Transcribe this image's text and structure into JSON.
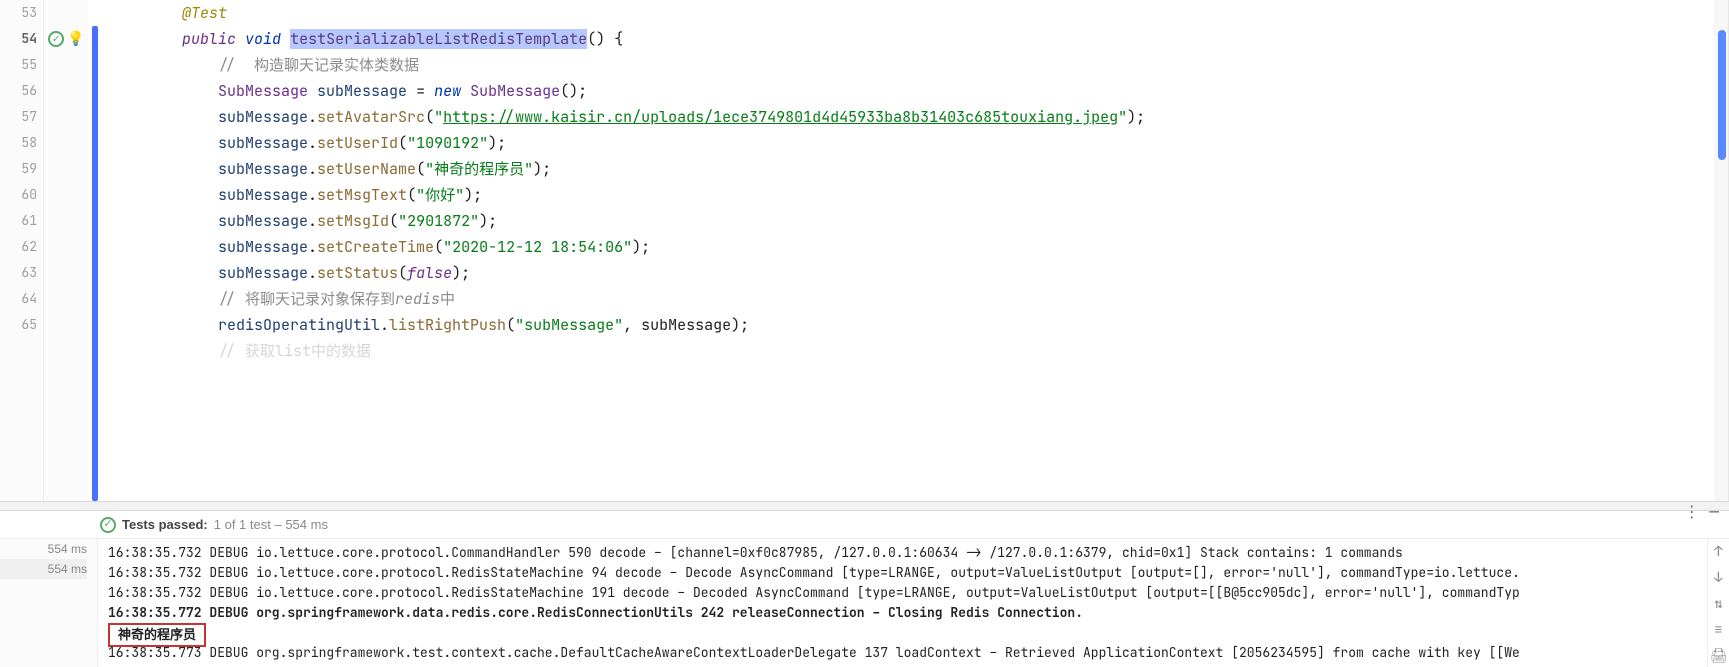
{
  "editor": {
    "lines": [
      {
        "num": "53",
        "indent": "        ",
        "segs": [
          {
            "t": "@Test",
            "c": "kw-anno"
          }
        ]
      },
      {
        "num": "54",
        "current": true,
        "markers": [
          "ok",
          "bulb"
        ],
        "indent": "        ",
        "segs": [
          {
            "t": "public",
            "c": "kw-pub"
          },
          {
            "t": " "
          },
          {
            "t": "void",
            "c": "kw-void"
          },
          {
            "t": " "
          },
          {
            "t": "testSerializableListRedisTemplate",
            "c": "fname sel"
          },
          {
            "t": "() {"
          }
        ]
      },
      {
        "num": "55",
        "indent": "            ",
        "segs": [
          {
            "t": "//  构造聊天记录实体类数据",
            "c": "cmt"
          }
        ]
      },
      {
        "num": "56",
        "indent": "            ",
        "segs": [
          {
            "t": "SubMessage",
            "c": "type"
          },
          {
            "t": " "
          },
          {
            "t": "subMessage",
            "c": "ident"
          },
          {
            "t": " = "
          },
          {
            "t": "new",
            "c": "kw-new"
          },
          {
            "t": " "
          },
          {
            "t": "SubMessage",
            "c": "type"
          },
          {
            "t": "();"
          }
        ]
      },
      {
        "num": "57",
        "indent": "            ",
        "segs": [
          {
            "t": "subMessage",
            "c": "ident"
          },
          {
            "t": "."
          },
          {
            "t": "setAvatarSrc",
            "c": "call"
          },
          {
            "t": "("
          },
          {
            "t": "\"",
            "c": "str"
          },
          {
            "t": "https://www.kaisir.cn/uploads/1ece3749801d4d45933ba8b31403c685touxiang.jpeg",
            "c": "strurl"
          },
          {
            "t": "\"",
            "c": "str"
          },
          {
            "t": ");"
          }
        ]
      },
      {
        "num": "58",
        "indent": "            ",
        "segs": [
          {
            "t": "subMessage",
            "c": "ident"
          },
          {
            "t": "."
          },
          {
            "t": "setUserId",
            "c": "call"
          },
          {
            "t": "("
          },
          {
            "t": "\"1090192\"",
            "c": "str"
          },
          {
            "t": ");"
          }
        ]
      },
      {
        "num": "59",
        "indent": "            ",
        "segs": [
          {
            "t": "subMessage",
            "c": "ident"
          },
          {
            "t": "."
          },
          {
            "t": "setUserName",
            "c": "call"
          },
          {
            "t": "("
          },
          {
            "t": "\"神奇的程序员\"",
            "c": "str"
          },
          {
            "t": ");"
          }
        ]
      },
      {
        "num": "60",
        "indent": "            ",
        "segs": [
          {
            "t": "subMessage",
            "c": "ident"
          },
          {
            "t": "."
          },
          {
            "t": "setMsgText",
            "c": "call"
          },
          {
            "t": "("
          },
          {
            "t": "\"你好\"",
            "c": "str"
          },
          {
            "t": ");"
          }
        ]
      },
      {
        "num": "61",
        "indent": "            ",
        "segs": [
          {
            "t": "subMessage",
            "c": "ident"
          },
          {
            "t": "."
          },
          {
            "t": "setMsgId",
            "c": "call"
          },
          {
            "t": "("
          },
          {
            "t": "\"2901872\"",
            "c": "str"
          },
          {
            "t": ");"
          }
        ]
      },
      {
        "num": "62",
        "indent": "            ",
        "segs": [
          {
            "t": "subMessage",
            "c": "ident"
          },
          {
            "t": "."
          },
          {
            "t": "setCreateTime",
            "c": "call"
          },
          {
            "t": "("
          },
          {
            "t": "\"2020-12-12 18:54:06\"",
            "c": "str"
          },
          {
            "t": ");"
          }
        ]
      },
      {
        "num": "63",
        "indent": "            ",
        "segs": [
          {
            "t": "subMessage",
            "c": "ident"
          },
          {
            "t": "."
          },
          {
            "t": "setStatus",
            "c": "call"
          },
          {
            "t": "("
          },
          {
            "t": "false",
            "c": "false"
          },
          {
            "t": ");"
          }
        ]
      },
      {
        "num": "64",
        "indent": "            ",
        "segs": [
          {
            "t": "// 将聊天记录对象保存到",
            "c": "cmt"
          },
          {
            "t": "redis",
            "c": "cmtital"
          },
          {
            "t": "中",
            "c": "cmt"
          }
        ]
      },
      {
        "num": "65",
        "indent": "            ",
        "segs": [
          {
            "t": "redisOperatingUtil",
            "c": "ident"
          },
          {
            "t": "."
          },
          {
            "t": "listRightPush",
            "c": "call"
          },
          {
            "t": "("
          },
          {
            "t": "\"subMessage\"",
            "c": "str"
          },
          {
            "t": ", subMessage);"
          }
        ]
      },
      {
        "num": "",
        "indent": "            ",
        "segs": [
          {
            "t": "// 获取list中的数据",
            "c": "cmt"
          }
        ],
        "faded": true
      }
    ]
  },
  "testHeader": {
    "prefix": "Tests passed:",
    "count": "1",
    "mid": " of 1 test – ",
    "time": "554 ms"
  },
  "timings": [
    "554 ms",
    "554 ms"
  ],
  "console": {
    "lines": [
      "16:38:35.732 DEBUG io.lettuce.core.protocol.CommandHandler 590 decode – [channel=0xf0c87985, /127.0.0.1:60634 -> /127.0.0.1:6379, chid=0x1] Stack contains: 1 commands",
      "16:38:35.732 DEBUG io.lettuce.core.protocol.RedisStateMachine 94 decode – Decode AsyncCommand [type=LRANGE, output=ValueListOutput [output=[], error='null'], commandType=io.lettuce.",
      "16:38:35.732 DEBUG io.lettuce.core.protocol.RedisStateMachine 191 decode – Decoded AsyncCommand [type=LRANGE, output=ValueListOutput [output=[[B@5cc905dc], error='null'], commandTyp",
      "16:38:35.772 DEBUG org.springframework.data.redis.core.RedisConnectionUtils 242 releaseConnection – Closing Redis Connection.",
      "神奇的程序员",
      "16:38:35.773 DEBUG org.springframework.test.context.cache.DefaultCacheAwareContextLoaderDelegate 137 loadContext – Retrieved ApplicationContext [2056234595] from cache with key [[We"
    ],
    "bold_indices": [
      3,
      4
    ],
    "box_index": 4
  },
  "sideTools": [
    "↑",
    "↓",
    "⇅",
    "≡",
    "🖨"
  ]
}
